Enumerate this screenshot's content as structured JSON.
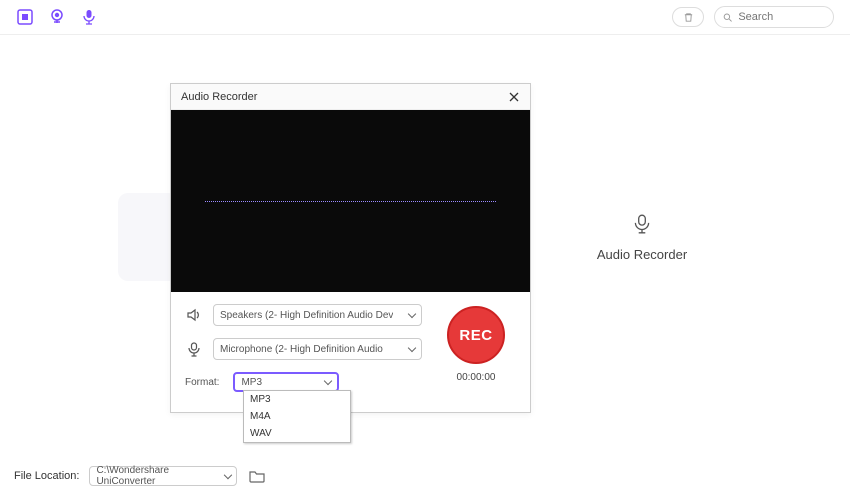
{
  "topbar": {
    "search_placeholder": "Search"
  },
  "bg_card": {
    "label": "Audio Recorder"
  },
  "dialog": {
    "title": "Audio Recorder",
    "speaker_device": "Speakers (2- High Definition Audio Dev",
    "mic_device": "Microphone (2- High Definition Audio",
    "format_label": "Format:",
    "format_selected": "MP3",
    "format_options": [
      "MP3",
      "M4A",
      "WAV"
    ],
    "rec_label": "REC",
    "time": "00:00:00"
  },
  "footer": {
    "label": "File Location:",
    "path": "C:\\Wondershare UniConverter"
  }
}
